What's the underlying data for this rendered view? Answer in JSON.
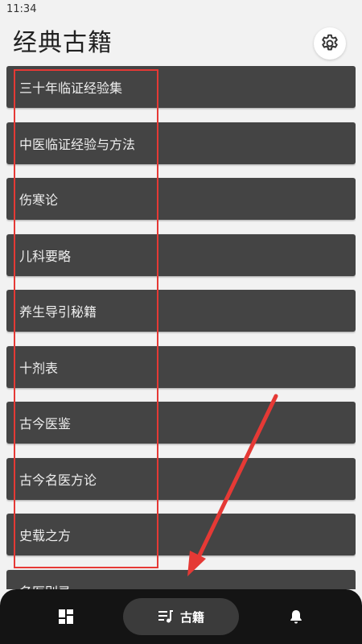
{
  "status_bar": {
    "time": "11:34"
  },
  "header": {
    "title": "经典古籍"
  },
  "books": [
    {
      "title": "三十年临证经验集"
    },
    {
      "title": "中医临证经验与方法"
    },
    {
      "title": "伤寒论"
    },
    {
      "title": "儿科要略"
    },
    {
      "title": "养生导引秘籍"
    },
    {
      "title": "十剂表"
    },
    {
      "title": "古今医鉴"
    },
    {
      "title": "古今名医方论"
    },
    {
      "title": "史载之方"
    },
    {
      "title": "名医别录"
    }
  ],
  "bottom_nav": {
    "items": [
      {
        "icon": "dashboard-icon",
        "label": ""
      },
      {
        "icon": "books-icon",
        "label": "古籍"
      },
      {
        "icon": "bell-icon",
        "label": ""
      }
    ]
  },
  "annotation": {
    "color": "#e53935"
  }
}
